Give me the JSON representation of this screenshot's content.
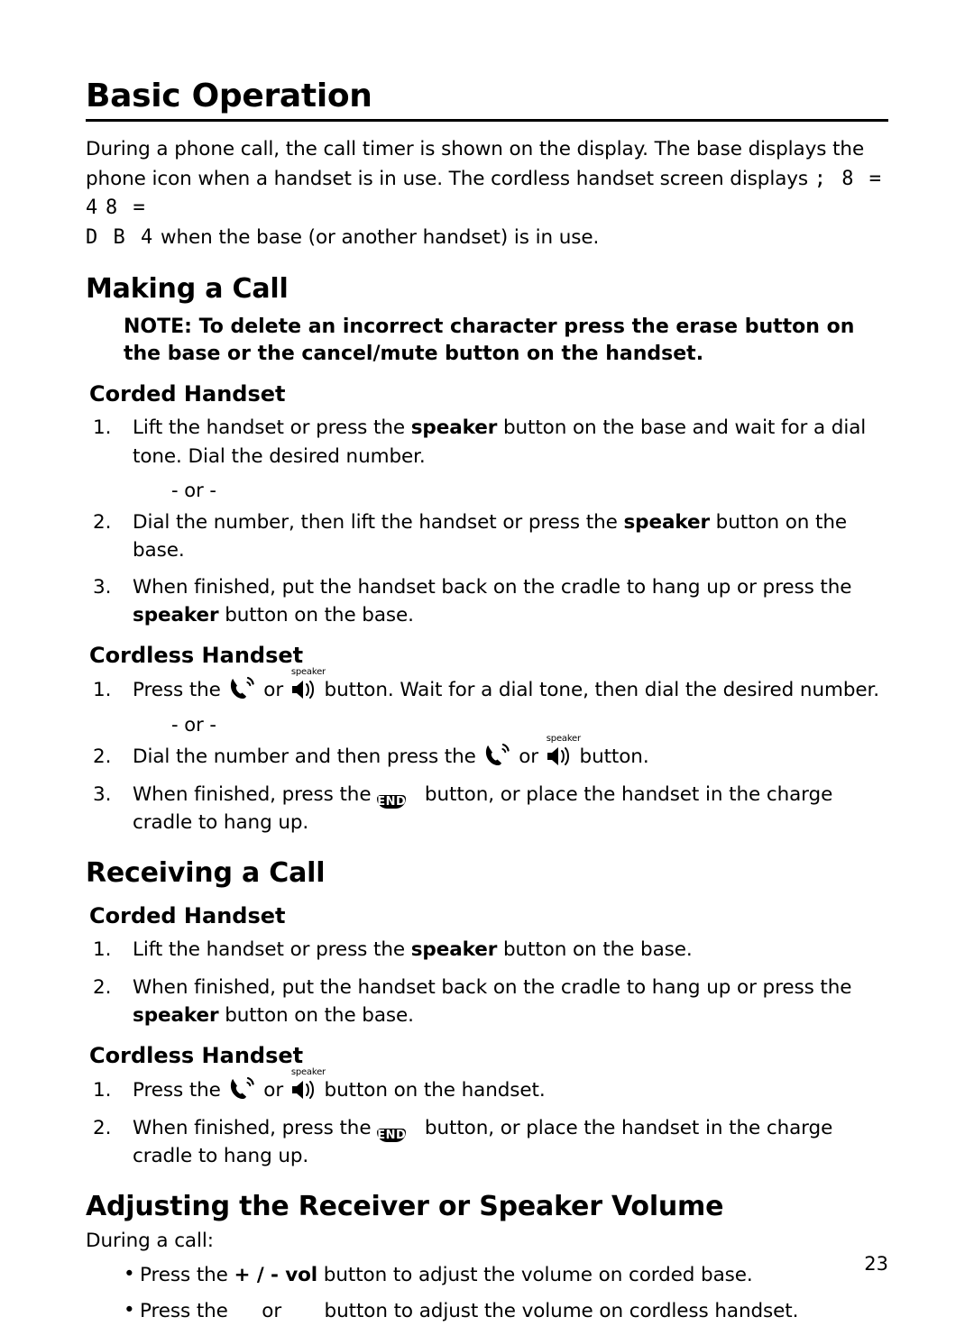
{
  "page": {
    "title": "Basic Operation",
    "number": "23"
  },
  "intro": {
    "line1": "During a phone call, the call timer is shown on the display. The base displays the",
    "line2": "phone icon when a handset is in use. The cordless handset screen displays",
    "lcd1": "; 8 = 4",
    "lcd2": "8 =",
    "lcd3": "D B 4",
    "line3": "when the base (or another handset) is in use."
  },
  "making_a_call": {
    "heading": "Making a Call",
    "note": "NOTE: To delete an incorrect character press the erase button on the base or the cancel/mute button on the handset.",
    "corded": {
      "heading": "Corded Handset",
      "steps": [
        {
          "num": "1.",
          "pre": "Lift the handset or press the ",
          "bold": "speaker",
          "post": " button on the base and wait for a dial tone. Dial the desired number."
        },
        {
          "num": "2.",
          "pre": "Dial the number, then lift the handset or press the ",
          "bold": "speaker",
          "post": " button on the base."
        },
        {
          "num": "3.",
          "pre": "When finished, put the handset back on the cradle to hang up or press the ",
          "bold": "speaker",
          "post": " button on the base."
        }
      ],
      "or": "- or -"
    },
    "cordless": {
      "heading": "Cordless Handset",
      "or": "- or -",
      "step1_pre": "Press the",
      "step1_mid": "or",
      "step1_post": "button. Wait for a dial tone, then dial the desired number.",
      "step2_pre": "Dial the number and then press the",
      "step2_mid": "or",
      "step2_post": "button.",
      "step3_pre": "When finished, press the",
      "step3_post": "button, or place the handset in the charge cradle to hang up.",
      "num1": "1.",
      "num2": "2.",
      "num3": "3."
    }
  },
  "receiving_a_call": {
    "heading": "Receiving a Call",
    "corded": {
      "heading": "Corded Handset",
      "steps": [
        {
          "num": "1.",
          "pre": "Lift the handset or press the ",
          "bold": "speaker",
          "post": " button on the base."
        },
        {
          "num": "2.",
          "pre": "When finished, put the handset back on the cradle to hang up or press the ",
          "bold": "speaker",
          "post": " button on the base."
        }
      ]
    },
    "cordless": {
      "heading": "Cordless Handset",
      "num1": "1.",
      "num2": "2.",
      "step1_pre": "Press the",
      "step1_mid": "or",
      "step1_post": "button on the handset.",
      "step2_pre": "When finished, press the",
      "step2_post": "button, or place the handset in the charge cradle to hang up."
    }
  },
  "volume": {
    "heading": "Adjusting the Receiver or Speaker Volume",
    "during": "During a call:",
    "bullet1_pre": "Press the ",
    "bullet1_bold": "+ / - vol",
    "bullet1_post": " button to adjust the volume on corded base.",
    "bullet2_pre": "Press the",
    "bullet2_mid": "or",
    "bullet2_post": "button to adjust the volume on cordless handset.",
    "bullet_dot": "•"
  },
  "icons": {
    "talk": "talk-handset-icon",
    "speaker": "speaker-icon",
    "speaker_label": "speaker",
    "end": "END"
  }
}
